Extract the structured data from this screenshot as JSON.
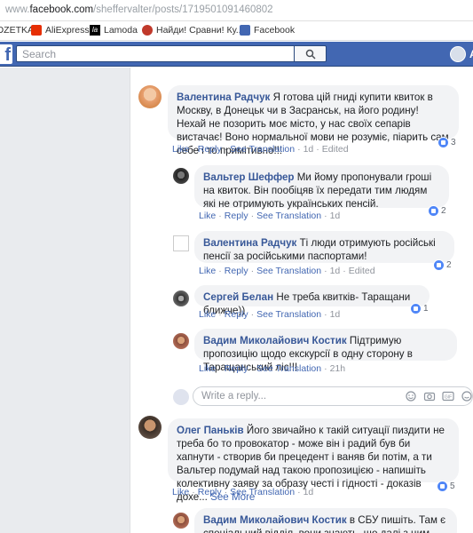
{
  "browser": {
    "url_prefix": "www.",
    "url_domain": "facebook.com",
    "url_path": "/sheffervalter/posts/1719501091460802"
  },
  "bookmarks": [
    {
      "label": "OZETKA",
      "icon": "bookmark-icon"
    },
    {
      "label": "AliExpress",
      "icon": "aliexpress-icon",
      "color": "#e62e04"
    },
    {
      "label": "Lamoda",
      "icon": "lamoda-icon"
    },
    {
      "label": "Найди! Сравни! Ку...",
      "icon": "search-engine-icon",
      "color": "#c0392b"
    },
    {
      "label": "Facebook",
      "icon": "facebook-icon",
      "color": "#4267b2"
    }
  ],
  "fbnav": {
    "logo": "f",
    "search_placeholder": "Search",
    "profile_initial": "A"
  },
  "comments": [
    {
      "author": "Валентина Радчук",
      "text": "Я готова цій гниді купити квиток в Москву, в Донецьк чи в Засранськ, на його родину! Нехай не позорить моє місто, у нас своїх сепарів вистачає! Воно нормальної мови не розуміє, піарить сам себе і то примітивно!!!",
      "like": "Like",
      "reply": "Reply",
      "see_translation": "See Translation",
      "time": "1d",
      "edited": "Edited",
      "reactions": "3"
    },
    {
      "author": "Вальтер Шеффер",
      "text": "Ми йому пропонували гроші на квиток. Він пообіцяв їх передати тим людям які не отримують українських пенсій.",
      "like": "Like",
      "reply": "Reply",
      "see_translation": "See Translation",
      "time": "1d",
      "reactions": "2"
    },
    {
      "author": "Валентина Радчук",
      "text": "Ті люди отримують російські пенсії за російськими паспортами!",
      "like": "Like",
      "reply": "Reply",
      "see_translation": "See Translation",
      "time": "1d",
      "edited": "Edited",
      "reactions": "2"
    },
    {
      "author": "Сергей Белан",
      "text": "Не треба квитків- Таращани ближче))",
      "like": "Like",
      "reply": "Reply",
      "see_translation": "See Translation",
      "time": "1d",
      "reactions": "1"
    },
    {
      "author": "Вадим Миколайович Костик",
      "text": "Підтримую пропозицію щодо екскурсії в одну сторону в Таращанський ліс!!!",
      "like": "Like",
      "reply": "Reply",
      "see_translation": "See Translation",
      "time": "21h"
    },
    {
      "author": "Олег Паньків",
      "text": "Його звичайно к такій ситуації пиздити не треба бо то провокатор - може він і радий був би хапнути - створив би прецедент і ваняв би потім, а ти Вальтер подумай над такою пропозицією - напишіть колективну заяву за образу честі і гідності - доказів дохе...",
      "see_more": "See More",
      "like": "Like",
      "reply": "Reply",
      "see_translation": "See Translation",
      "time": "1d",
      "reactions": "5"
    },
    {
      "author": "Вадим Миколайович Костик",
      "text": "в СБУ пишіть. Там є спеціальний відділ, вони знають, що далі з цим"
    }
  ],
  "reply_box": {
    "placeholder": "Write a reply..."
  }
}
